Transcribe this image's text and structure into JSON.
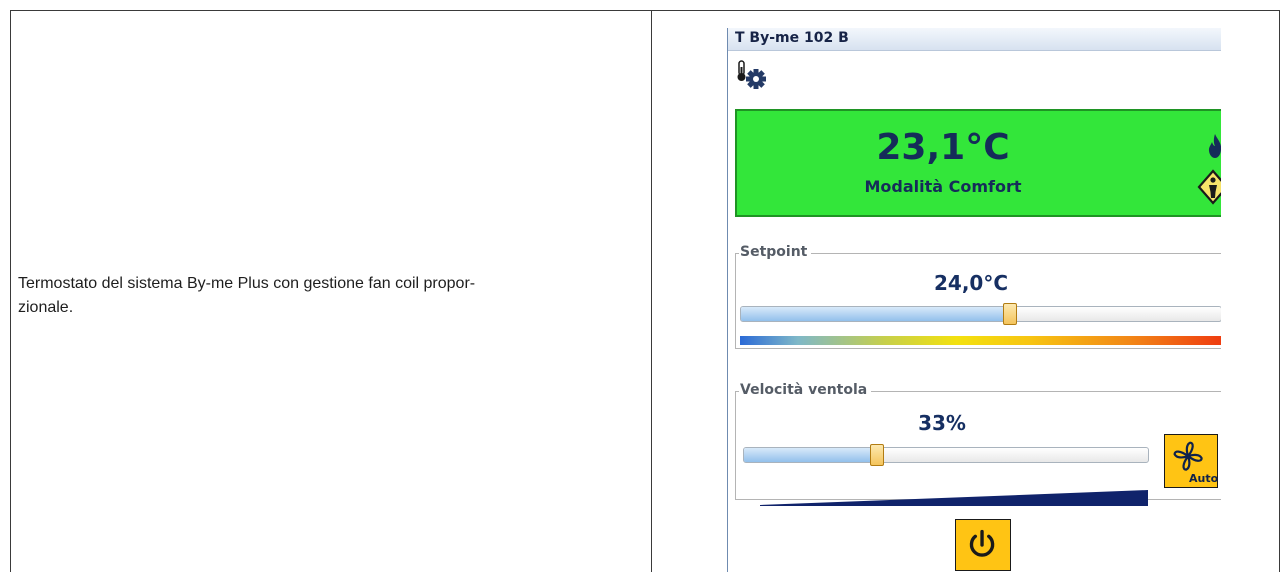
{
  "description": {
    "line1": "Termostato del sistema By-me Plus con gestione fan coil propor-",
    "line2": "zionale."
  },
  "panel": {
    "title": "T By-me 102 B",
    "status_icons": [
      "thermometer-icon",
      "gear-icon"
    ],
    "display": {
      "temperature": "23,1°C",
      "mode": "Modalità Comfort",
      "background_color": "#33e63a",
      "icons": [
        "flame-icon",
        "comfort-mode-icon"
      ]
    },
    "setpoint": {
      "legend": "Setpoint",
      "value": "24,0°C",
      "slider_fraction": 0.56
    },
    "fan_speed": {
      "legend": "Velocità ventola",
      "value": "33%",
      "slider_fraction": 0.33,
      "auto_button_label": "Auto"
    },
    "power_button_icon": "power-icon",
    "accent_color": "#ffc414",
    "text_color": "#152c59"
  }
}
